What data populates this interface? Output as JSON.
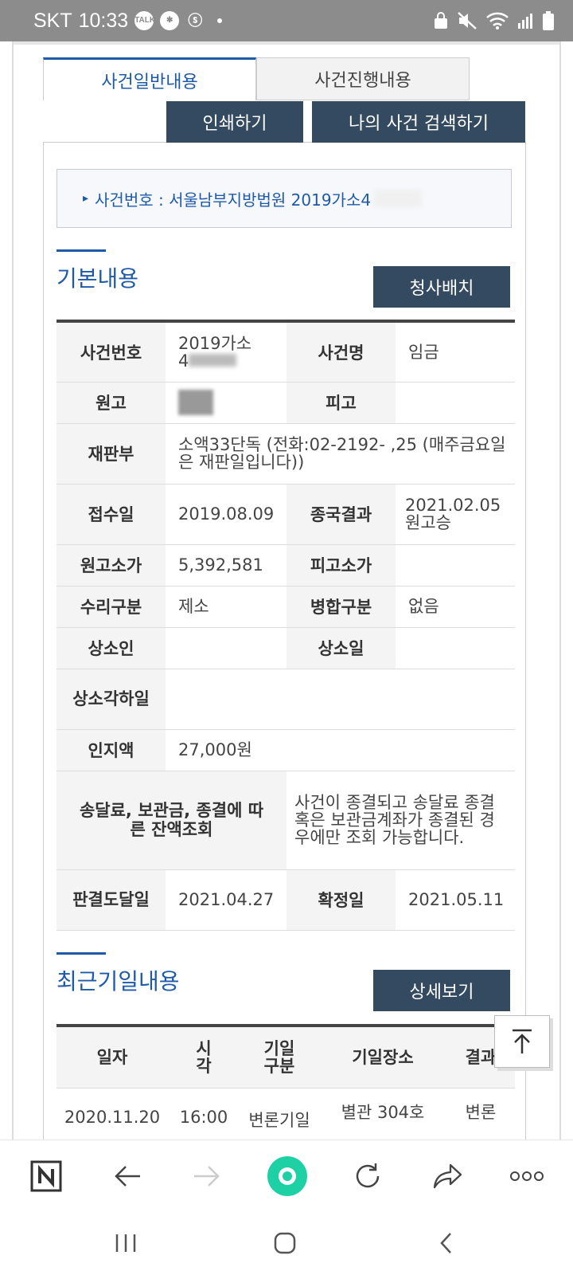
{
  "status_bar": {
    "carrier": "SKT",
    "time": "10:33",
    "notif_icons": [
      "talk-icon",
      "settings-badge-icon",
      "s-pass-icon"
    ]
  },
  "tabs": {
    "general": "사건일반내용",
    "progress": "사건진행내용"
  },
  "buttons": {
    "print": "인쇄하기",
    "search_my_case": "나의 사건 검색하기",
    "building_layout": "청사배치",
    "details": "상세보기"
  },
  "case_box": {
    "text": "사건번호 : 서울남부지방법원 2019가소4"
  },
  "basic": {
    "title": "기본내용",
    "rows": {
      "case_no_label": "사건번호",
      "case_no_line1": "2019가소",
      "case_no_line2": "4",
      "case_name_label": "사건명",
      "case_name": "임금",
      "plaintiff_label": "원고",
      "defendant_label": "피고",
      "court_label": "재판부",
      "court_value": "소액33단독 (전화:02-2192- ,25 (매주금요일은 재판일입니다))",
      "received_label": "접수일",
      "received": "2019.08.09",
      "final_result_label": "종국결과",
      "final_result_date": "2021.02.05",
      "final_result_text": "원고승",
      "plaintiff_claim_label": "원고소가",
      "plaintiff_claim": "5,392,581",
      "defendant_claim_label": "피고소가",
      "acceptance_label": "수리구분",
      "acceptance": "제소",
      "merge_label": "병합구분",
      "merge": "없음",
      "appellant_label": "상소인",
      "appeal_date_label": "상소일",
      "appeal_dismissal_label": "상소각하일",
      "stamp_label": "인지액",
      "stamp": "27,000원",
      "balance_label": "송달료, 보관금, 종결에 따른 잔액조회",
      "balance_text": "사건이 종결되고 송달료 종결 혹은 보관금계좌가 종결된 경우에만 조회 가능합니다.",
      "judgment_delivery_label": "판결도달일",
      "judgment_delivery": "2021.04.27",
      "confirmed_label": "확정일",
      "confirmed": "2021.05.11"
    }
  },
  "recent": {
    "title": "최근기일내용",
    "headers": {
      "date": "일자",
      "time": "시각",
      "type": "기일구분",
      "place": "기일장소",
      "result": "결과"
    },
    "row1": {
      "date": "2020.11.20",
      "time": "16:00",
      "type": "변론기일",
      "place": "별관 304호",
      "result": "변론"
    }
  },
  "colors": {
    "accent": "#1e5aa8",
    "dark_button": "#344a61",
    "status_bar": "#8c8c8c",
    "browser_center": "#1ed1a5"
  }
}
